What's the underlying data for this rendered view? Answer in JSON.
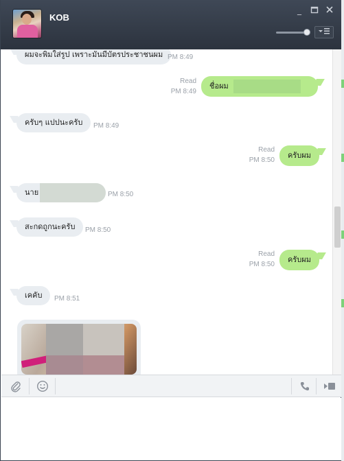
{
  "window": {
    "contact_name": "KOB"
  },
  "icons": {
    "minimize": "minimize-icon",
    "maximize": "maximize-icon",
    "close": "close-icon",
    "menu": "menu-icon",
    "attach": "paperclip-icon",
    "emoji": "smiley-icon",
    "call": "phone-icon",
    "video": "video-icon"
  },
  "colors": {
    "header": "#333b47",
    "incoming_bubble": "#e9edf1",
    "outgoing_bubble": "#b6ea8c"
  },
  "messages": [
    {
      "dir": "in",
      "text": "ผมจะพิมใส่รูป เพราะมันมีบัตรประชาชนผม",
      "time": "PM 8:49"
    },
    {
      "dir": "out",
      "text": "ชื่อผม",
      "status": "Read",
      "time": "PM 8:49"
    },
    {
      "dir": "in",
      "text": "ครับๆ แปปนะครับ",
      "time": "PM 8:49"
    },
    {
      "dir": "out",
      "text": "ครับผม",
      "status": "Read",
      "time": "PM 8:50"
    },
    {
      "dir": "in",
      "text": "นาย",
      "time": "PM 8:50"
    },
    {
      "dir": "in",
      "text": "สะกดถูกนะครับ",
      "time": "PM 8:50"
    },
    {
      "dir": "out",
      "text": "ครับผม",
      "status": "Read",
      "time": "PM 8:50"
    },
    {
      "dir": "in",
      "text": "เคคับ",
      "time": "PM 8:51"
    }
  ]
}
